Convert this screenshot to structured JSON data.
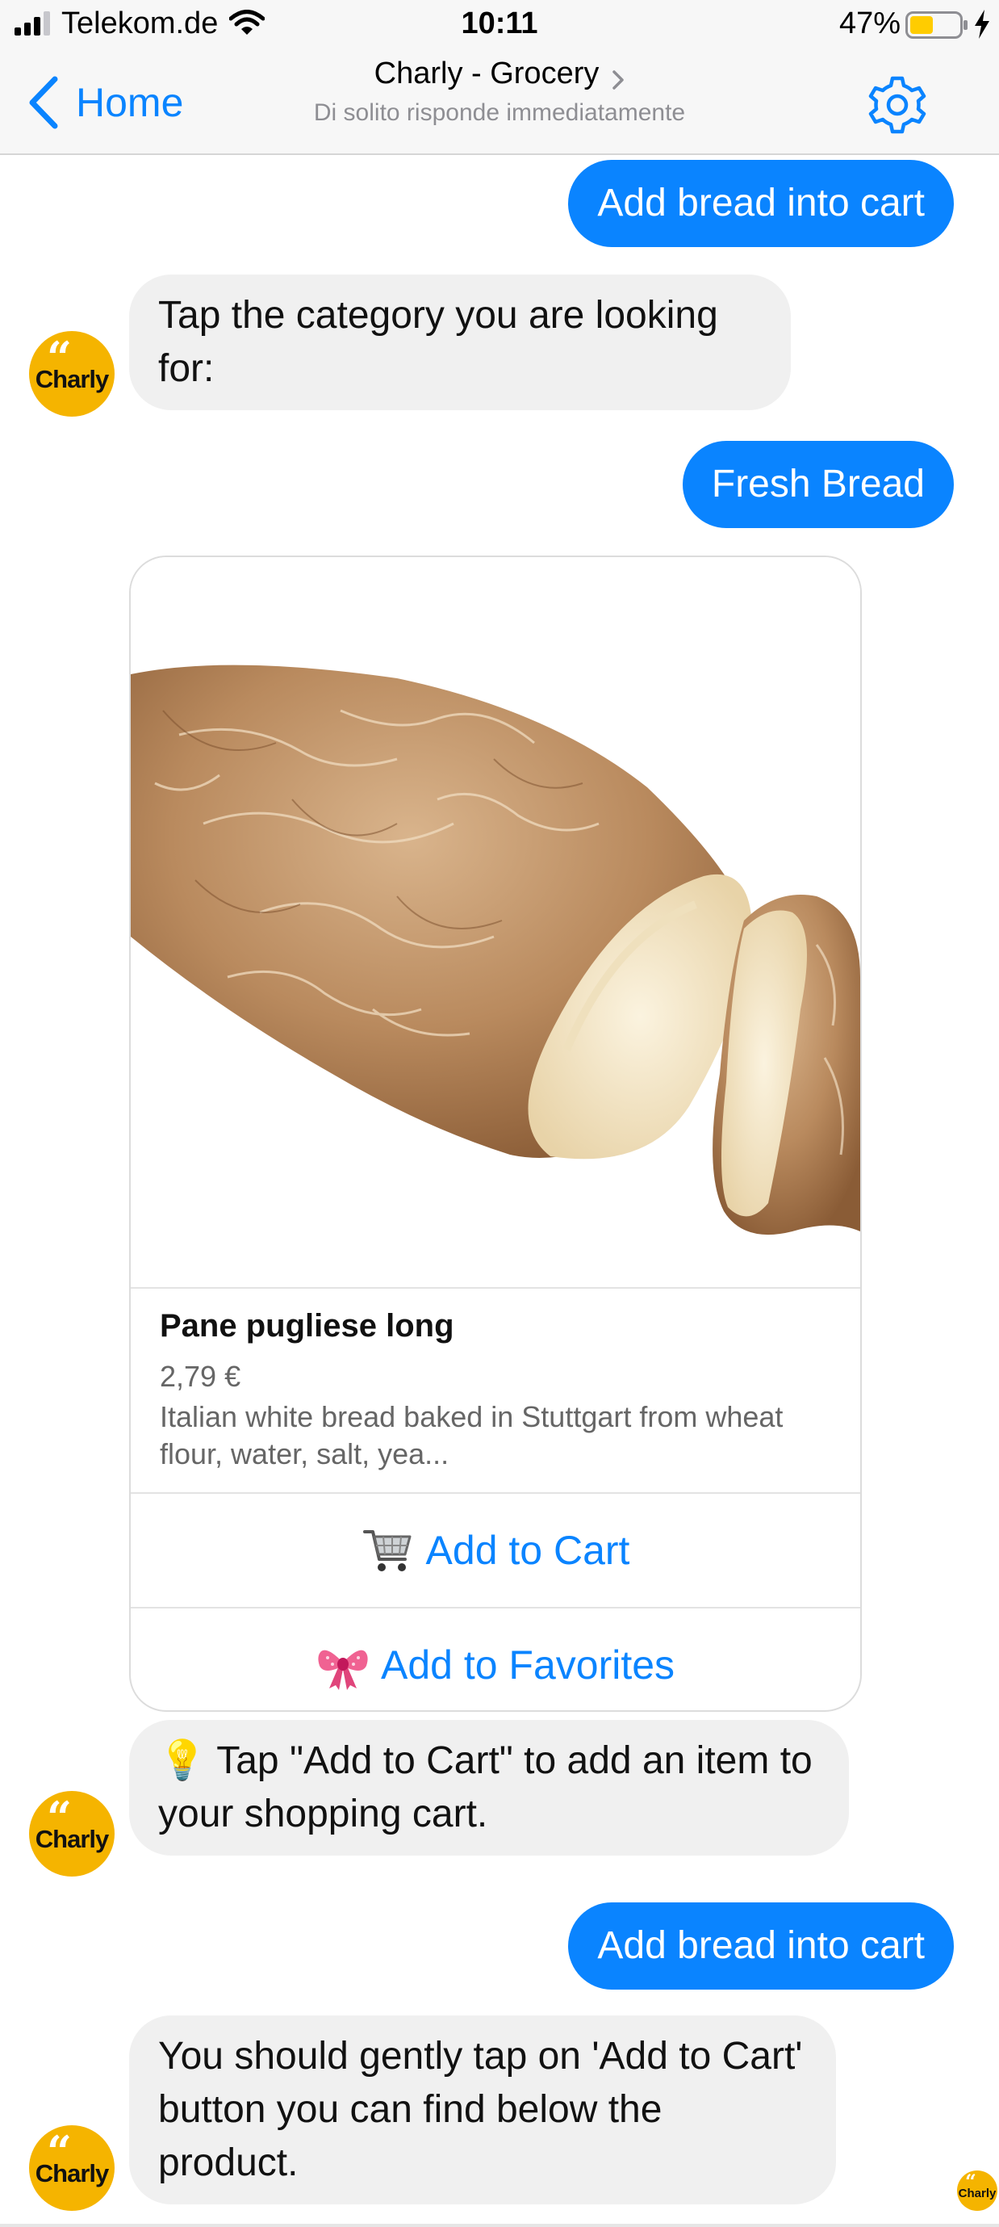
{
  "status_bar": {
    "carrier": "Telekom.de",
    "time": "10:11",
    "battery_percent": "47%",
    "battery_level": 0.47,
    "signal_icon": "signal-bars-icon",
    "wifi_icon": "wifi-icon",
    "charging_icon": "bolt-icon"
  },
  "nav": {
    "back_label": "Home",
    "title": "Charly - Grocery",
    "subtitle": "Di solito risponde immediatamente",
    "settings_icon": "gear-icon"
  },
  "colors": {
    "accent": "#0a84ff",
    "bot_avatar": "#f5b400",
    "incoming_bubble": "#f0f0f0"
  },
  "bot": {
    "avatar_text": "Charly"
  },
  "messages": {
    "m1": "Add bread into cart",
    "m2": "Tap the category you are looking for:",
    "m3": "Fresh Bread",
    "m5": "💡 Tap \"Add to Cart\" to add an item to your shopping cart.",
    "m6": "Add bread into cart",
    "m7": "You should gently tap on 'Add to Cart' button you can find below the product."
  },
  "product_card": {
    "title": "Pane pugliese long",
    "price": "2,79 €",
    "description": "Italian white bread baked in Stuttgart from wheat flour, water, salt, yea...",
    "add_to_cart_label": "Add to Cart",
    "add_to_cart_icon": "shopping-cart-icon",
    "add_to_favorites_label": "Add to Favorites",
    "add_to_favorites_icon": "ribbon-bow-icon"
  }
}
